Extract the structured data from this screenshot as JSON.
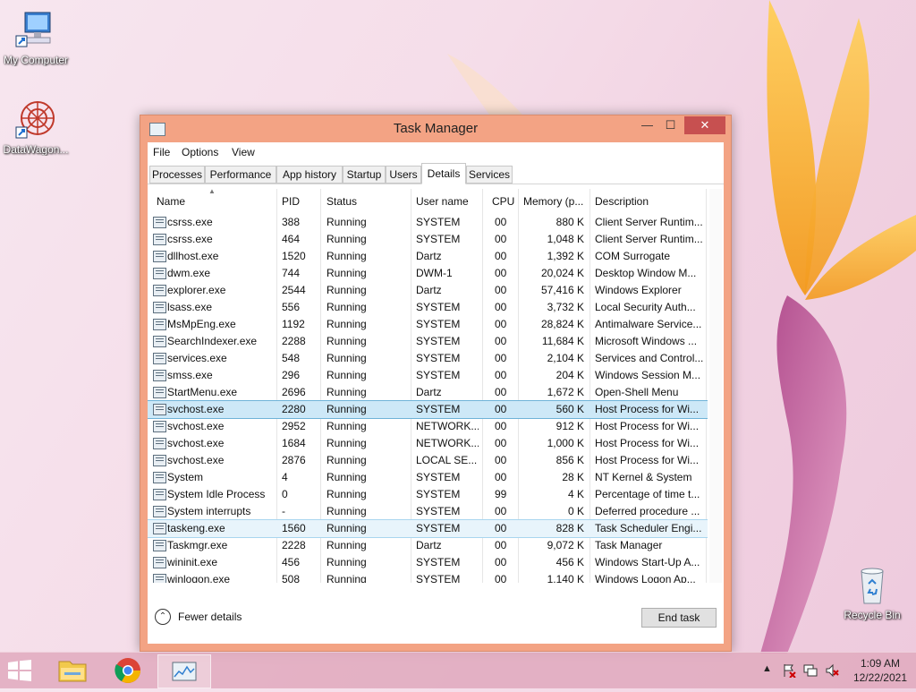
{
  "desktop": {
    "icons": [
      {
        "label": "My Computer"
      },
      {
        "label": "DataWagon..."
      },
      {
        "label": "Recycle Bin"
      }
    ]
  },
  "window": {
    "title": "Task Manager",
    "min": "—",
    "max": "☐",
    "close": "✕"
  },
  "menu": [
    "File",
    "Options",
    "View"
  ],
  "tabs": [
    "Processes",
    "Performance",
    "App history",
    "Startup",
    "Users",
    "Details",
    "Services"
  ],
  "active_tab": "Details",
  "columns": [
    "Name",
    "PID",
    "Status",
    "User name",
    "CPU",
    "Memory (p...",
    "Description"
  ],
  "rows": [
    {
      "name": "csrss.exe",
      "pid": "388",
      "status": "Running",
      "user": "SYSTEM",
      "cpu": "00",
      "mem": "880 K",
      "desc": "Client Server Runtim..."
    },
    {
      "name": "csrss.exe",
      "pid": "464",
      "status": "Running",
      "user": "SYSTEM",
      "cpu": "00",
      "mem": "1,048 K",
      "desc": "Client Server Runtim..."
    },
    {
      "name": "dllhost.exe",
      "pid": "1520",
      "status": "Running",
      "user": "Dartz",
      "cpu": "00",
      "mem": "1,392 K",
      "desc": "COM Surrogate"
    },
    {
      "name": "dwm.exe",
      "pid": "744",
      "status": "Running",
      "user": "DWM-1",
      "cpu": "00",
      "mem": "20,024 K",
      "desc": "Desktop Window M..."
    },
    {
      "name": "explorer.exe",
      "pid": "2544",
      "status": "Running",
      "user": "Dartz",
      "cpu": "00",
      "mem": "57,416 K",
      "desc": "Windows Explorer"
    },
    {
      "name": "lsass.exe",
      "pid": "556",
      "status": "Running",
      "user": "SYSTEM",
      "cpu": "00",
      "mem": "3,732 K",
      "desc": "Local Security Auth..."
    },
    {
      "name": "MsMpEng.exe",
      "pid": "1192",
      "status": "Running",
      "user": "SYSTEM",
      "cpu": "00",
      "mem": "28,824 K",
      "desc": "Antimalware Service..."
    },
    {
      "name": "SearchIndexer.exe",
      "pid": "2288",
      "status": "Running",
      "user": "SYSTEM",
      "cpu": "00",
      "mem": "11,684 K",
      "desc": "Microsoft Windows ..."
    },
    {
      "name": "services.exe",
      "pid": "548",
      "status": "Running",
      "user": "SYSTEM",
      "cpu": "00",
      "mem": "2,104 K",
      "desc": "Services and Control..."
    },
    {
      "name": "smss.exe",
      "pid": "296",
      "status": "Running",
      "user": "SYSTEM",
      "cpu": "00",
      "mem": "204 K",
      "desc": "Windows Session M..."
    },
    {
      "name": "StartMenu.exe",
      "pid": "2696",
      "status": "Running",
      "user": "Dartz",
      "cpu": "00",
      "mem": "1,672 K",
      "desc": "Open-Shell Menu"
    },
    {
      "name": "svchost.exe",
      "pid": "2280",
      "status": "Running",
      "user": "SYSTEM",
      "cpu": "00",
      "mem": "560 K",
      "desc": "Host Process for Wi..."
    },
    {
      "name": "svchost.exe",
      "pid": "2952",
      "status": "Running",
      "user": "NETWORK...",
      "cpu": "00",
      "mem": "912 K",
      "desc": "Host Process for Wi..."
    },
    {
      "name": "svchost.exe",
      "pid": "1684",
      "status": "Running",
      "user": "NETWORK...",
      "cpu": "00",
      "mem": "1,000 K",
      "desc": "Host Process for Wi..."
    },
    {
      "name": "svchost.exe",
      "pid": "2876",
      "status": "Running",
      "user": "LOCAL SE...",
      "cpu": "00",
      "mem": "856 K",
      "desc": "Host Process for Wi..."
    },
    {
      "name": "System",
      "pid": "4",
      "status": "Running",
      "user": "SYSTEM",
      "cpu": "00",
      "mem": "28 K",
      "desc": "NT Kernel & System"
    },
    {
      "name": "System Idle Process",
      "pid": "0",
      "status": "Running",
      "user": "SYSTEM",
      "cpu": "99",
      "mem": "4 K",
      "desc": "Percentage of time t..."
    },
    {
      "name": "System interrupts",
      "pid": "-",
      "status": "Running",
      "user": "SYSTEM",
      "cpu": "00",
      "mem": "0 K",
      "desc": "Deferred procedure ..."
    },
    {
      "name": "taskeng.exe",
      "pid": "1560",
      "status": "Running",
      "user": "SYSTEM",
      "cpu": "00",
      "mem": "828 K",
      "desc": "Task Scheduler Engi..."
    },
    {
      "name": "Taskmgr.exe",
      "pid": "2228",
      "status": "Running",
      "user": "Dartz",
      "cpu": "00",
      "mem": "9,072 K",
      "desc": "Task Manager"
    },
    {
      "name": "wininit.exe",
      "pid": "456",
      "status": "Running",
      "user": "SYSTEM",
      "cpu": "00",
      "mem": "456 K",
      "desc": "Windows Start-Up A..."
    },
    {
      "name": "winlogon.exe",
      "pid": "508",
      "status": "Running",
      "user": "SYSTEM",
      "cpu": "00",
      "mem": "1,140 K",
      "desc": "Windows Logon Ap..."
    }
  ],
  "selected_row": 11,
  "hover_row": 18,
  "footer": {
    "fewer_details": "Fewer details",
    "end_task": "End task"
  },
  "clock": {
    "time": "1:09 AM",
    "date": "12/22/2021"
  },
  "tray": {
    "up_arrow": "▲"
  }
}
